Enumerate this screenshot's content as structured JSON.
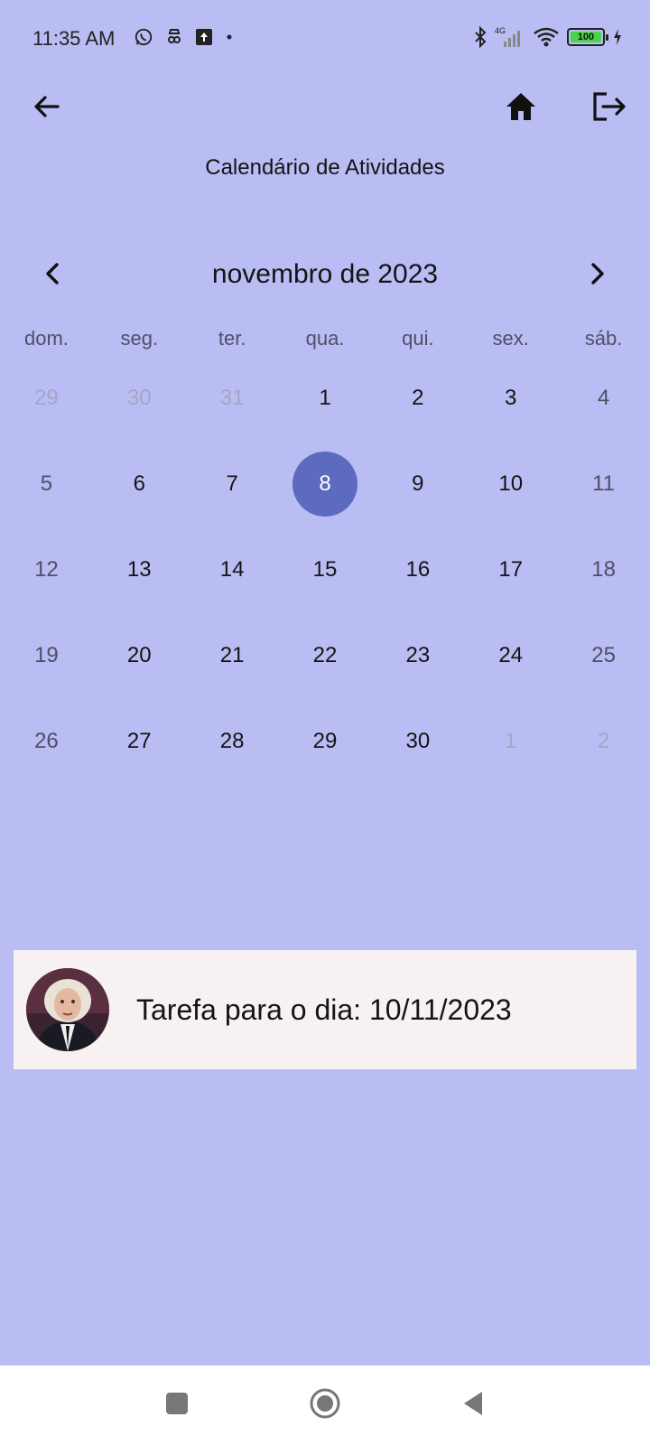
{
  "status_bar": {
    "time": "11:35 AM",
    "network": "4G",
    "battery": "100"
  },
  "app_bar": {
    "back_icon": "arrow-left-icon",
    "home_icon": "home-icon",
    "logout_icon": "logout-icon"
  },
  "page": {
    "title": "Calendário de Atividades"
  },
  "calendar": {
    "month_label": "novembro de 2023",
    "weekdays": [
      "dom.",
      "seg.",
      "ter.",
      "qua.",
      "qui.",
      "sex.",
      "sáb."
    ],
    "selected_day": "8",
    "selected_color": "#5c6bc0",
    "weeks": [
      [
        {
          "d": "29",
          "t": "outside"
        },
        {
          "d": "30",
          "t": "outside"
        },
        {
          "d": "31",
          "t": "outside"
        },
        {
          "d": "1",
          "t": "weekday-cell"
        },
        {
          "d": "2",
          "t": "weekday-cell"
        },
        {
          "d": "3",
          "t": "weekday-cell"
        },
        {
          "d": "4",
          "t": "weekend"
        }
      ],
      [
        {
          "d": "5",
          "t": "weekend"
        },
        {
          "d": "6",
          "t": "weekday-cell"
        },
        {
          "d": "7",
          "t": "weekday-cell"
        },
        {
          "d": "8",
          "t": "selected"
        },
        {
          "d": "9",
          "t": "weekday-cell"
        },
        {
          "d": "10",
          "t": "weekday-cell"
        },
        {
          "d": "11",
          "t": "weekend"
        }
      ],
      [
        {
          "d": "12",
          "t": "weekend"
        },
        {
          "d": "13",
          "t": "weekday-cell"
        },
        {
          "d": "14",
          "t": "weekday-cell"
        },
        {
          "d": "15",
          "t": "weekday-cell"
        },
        {
          "d": "16",
          "t": "weekday-cell"
        },
        {
          "d": "17",
          "t": "weekday-cell"
        },
        {
          "d": "18",
          "t": "weekend"
        }
      ],
      [
        {
          "d": "19",
          "t": "weekend"
        },
        {
          "d": "20",
          "t": "weekday-cell"
        },
        {
          "d": "21",
          "t": "weekday-cell"
        },
        {
          "d": "22",
          "t": "weekday-cell"
        },
        {
          "d": "23",
          "t": "weekday-cell"
        },
        {
          "d": "24",
          "t": "weekday-cell"
        },
        {
          "d": "25",
          "t": "weekend"
        }
      ],
      [
        {
          "d": "26",
          "t": "weekend"
        },
        {
          "d": "27",
          "t": "weekday-cell"
        },
        {
          "d": "28",
          "t": "weekday-cell"
        },
        {
          "d": "29",
          "t": "weekday-cell"
        },
        {
          "d": "30",
          "t": "weekday-cell"
        },
        {
          "d": "1",
          "t": "outside"
        },
        {
          "d": "2",
          "t": "outside"
        }
      ]
    ]
  },
  "task_card": {
    "text": "Tarefa para o dia: 10/11/2023",
    "avatar_icon": "avatar-photo"
  },
  "colors": {
    "background": "#b9bdf3",
    "card": "#f7f1f2",
    "accent": "#5c6bc0"
  }
}
